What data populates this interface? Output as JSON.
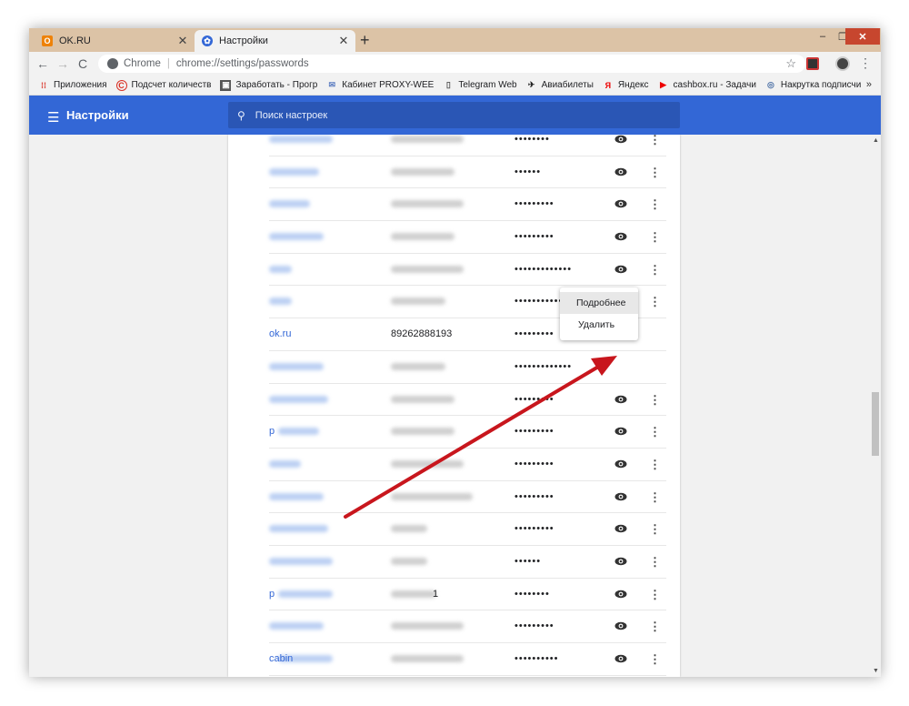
{
  "tabs": [
    {
      "title": "OK.RU",
      "close": "✕",
      "icon": "ok-icon"
    },
    {
      "title": "Настройки",
      "close": "✕",
      "icon": "gear-icon"
    }
  ],
  "new_tab": "+",
  "window_controls": {
    "minimize": "–",
    "maximize": "❐",
    "close": "✕"
  },
  "toolbar": {
    "back": "←",
    "forward": "→",
    "reload": "C",
    "chrome_label": "Chrome",
    "separator": "|",
    "url": "chrome://settings/passwords",
    "star": "☆",
    "menu": "⋮"
  },
  "bookmarks": {
    "items": [
      {
        "label": "Приложения",
        "icon": "apps-icon"
      },
      {
        "label": "Подсчет количеств",
        "icon": "copyright-icon"
      },
      {
        "label": "Заработать - Прогр",
        "icon": "page-icon"
      },
      {
        "label": "Кабинет PROXY-WEE",
        "icon": "envelope-icon"
      },
      {
        "label": "Telegram Web",
        "icon": "document-icon"
      },
      {
        "label": "Авиабилеты",
        "icon": "plane-icon"
      },
      {
        "label": "Яндекс",
        "icon": "yandex-icon"
      },
      {
        "label": "cashbox.ru - Задачи",
        "icon": "play-icon"
      },
      {
        "label": "Накрутка подписчи",
        "icon": "globe-icon"
      }
    ],
    "more": "»"
  },
  "settings": {
    "menu_icon": "☰",
    "title": "Настройки",
    "search_icon": "🔍",
    "search_placeholder": "Поиск настроек"
  },
  "passwords": [
    {
      "site": "",
      "user": "",
      "password": "••••••••"
    },
    {
      "site": "",
      "user": "",
      "password": "••••••"
    },
    {
      "site": "",
      "user": "",
      "password": "•••••••••"
    },
    {
      "site": "",
      "user": "",
      "password": "•••••••••"
    },
    {
      "site": "",
      "user": "",
      "password": "•••••••••••••"
    },
    {
      "site": "",
      "user": "",
      "password": "••••••••••••••"
    },
    {
      "site": "ok.ru",
      "user": "89262888193",
      "password": "•••••••••"
    },
    {
      "site": "",
      "user": "",
      "password": "•••••••••••••"
    },
    {
      "site": "",
      "user": "",
      "password": "•••••••••"
    },
    {
      "site": "p",
      "user": "",
      "password": "•••••••••"
    },
    {
      "site": "",
      "user": "",
      "password": "•••••••••"
    },
    {
      "site": "",
      "user": "",
      "password": "•••••••••"
    },
    {
      "site": "",
      "user": "",
      "password": "•••••••••"
    },
    {
      "site": "",
      "user": "",
      "password": "••••••"
    },
    {
      "site": "p",
      "user": "1",
      "password": "••••••••"
    },
    {
      "site": "",
      "user": "",
      "password": "•••••••••"
    },
    {
      "site": "cabin",
      "user": "",
      "password": "••••••••••"
    }
  ],
  "row_more": "⋮",
  "context_menu": {
    "details": "Подробнее",
    "delete": "Удалить"
  },
  "scrollbar": {
    "up": "▲",
    "down": "▼"
  },
  "colors": {
    "accent": "#3367d6",
    "tabstrip": "#dcc3a6",
    "arrow": "#c8161d"
  }
}
